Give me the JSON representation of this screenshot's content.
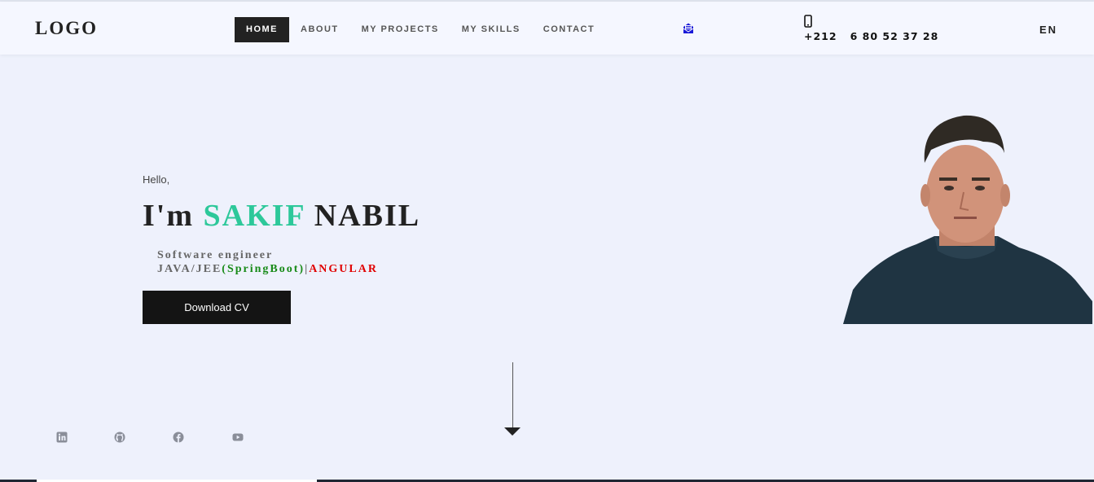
{
  "header": {
    "logo": "LOGO",
    "nav": [
      {
        "label": "HOME",
        "active": true
      },
      {
        "label": "ABOUT"
      },
      {
        "label": "MY PROJECTS"
      },
      {
        "label": "MY SKILLS"
      },
      {
        "label": "CONTACT"
      }
    ],
    "mail_icon": "envelope-icon",
    "phone_icon": "mobile-phone-icon",
    "phone": "+212   6 80 52 37 28",
    "language": "EN"
  },
  "hero": {
    "greeting": "Hello,",
    "name_prefix": "I'm",
    "first_name": "SAKIF",
    "last_name": "NABIL",
    "role_line1": "Software engineer",
    "role_java": "JAVA/JEE",
    "role_spring": "(SpringBoot)",
    "role_sep": "|",
    "role_angular": "ANGULAR",
    "cv_button": "Download CV"
  },
  "social": [
    {
      "name": "linkedin-icon"
    },
    {
      "name": "github-icon"
    },
    {
      "name": "facebook-icon"
    },
    {
      "name": "youtube-icon"
    }
  ],
  "colors": {
    "accent": "#2dc89a",
    "spring": "#178a17",
    "angular": "#e00000",
    "mail": "#1a1ad8",
    "dark": "#141414",
    "background": "#eef1fc"
  }
}
